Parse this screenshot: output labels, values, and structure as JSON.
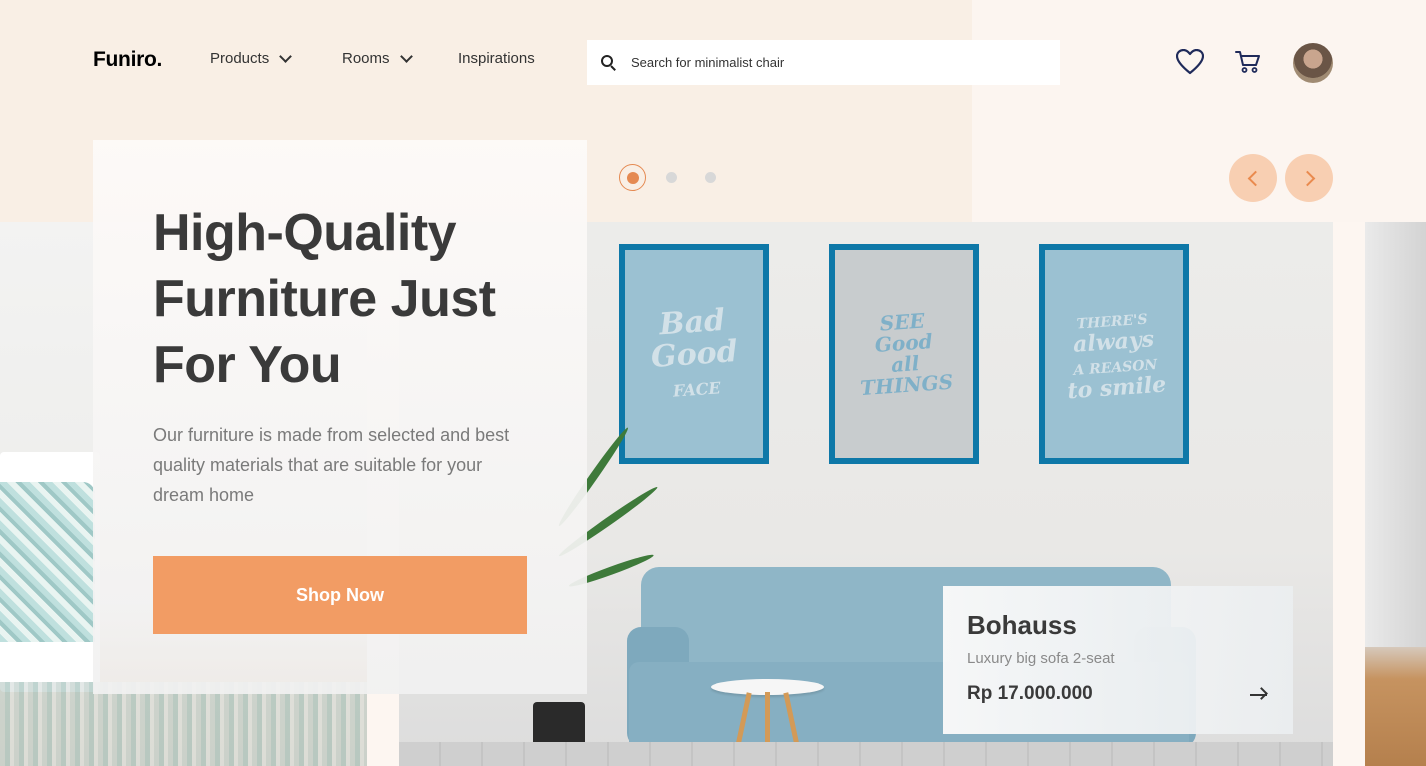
{
  "brand": {
    "logo": "Funiro."
  },
  "nav": {
    "products": "Products",
    "rooms": "Rooms",
    "inspirations": "Inspirations"
  },
  "search": {
    "placeholder": "Search for minimalist chair",
    "value": ""
  },
  "header_icons": [
    "heart-icon",
    "cart-icon",
    "avatar"
  ],
  "hero": {
    "title": "High-Quality Furniture Just For You",
    "subtitle": "Our furniture is made from selected and best quality materials that are suitable for your dream home",
    "cta_label": "Shop Now"
  },
  "slider": {
    "dots": 3,
    "active_index": 0
  },
  "product": {
    "name": "Bohauss",
    "description": "Luxury big sofa 2-seat",
    "price": "Rp 17.000.000"
  },
  "colors": {
    "accent": "#f29c64",
    "accent_dark": "#e98a4e",
    "arrow_bg": "#f8cfb2",
    "header_bg": "#f9efe5",
    "text_dark": "#3a3a3a",
    "text_muted": "#7a7a7a"
  }
}
